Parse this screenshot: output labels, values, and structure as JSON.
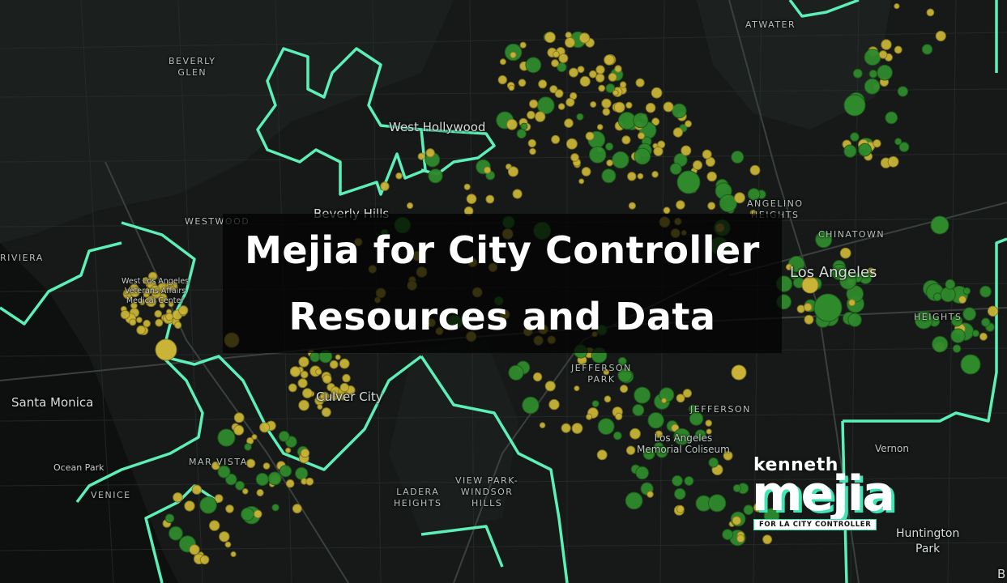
{
  "map": {
    "place_labels": {
      "beverly_glen": "BEVERLY\nGLEN",
      "atwater": "ATWATER",
      "west_hollywood": "West Hollywood",
      "westwood": "WESTWOOD",
      "beverly_hills": "Beverly Hills",
      "angelino_heights": "ANGELINO\nHEIGHTS",
      "chinatown": "CHINATOWN",
      "los_angeles": "Los Angeles",
      "riviera": "RIVIERA",
      "west_la_va": "West Los Angeles\nVeterans Affairs\nMedical Center",
      "heights": "HEIGHTS",
      "jefferson_park": "JEFFERSON\nPARK",
      "santa_monica": "Santa Monica",
      "culver_city": "Culver City",
      "jefferson": "JEFFERSON",
      "la_memorial_coliseum": "Los Angeles\nMemorial Coliseum",
      "vernon": "Vernon",
      "mar_vista": "MAR VISTA",
      "ocean_park": "Ocean Park",
      "venice": "VENICE",
      "ladera_heights": "LADERA\nHEIGHTS",
      "view_park_windsor_hills": "VIEW PARK-\nWINDSOR\nHILLS",
      "huntington_park": "Huntington\nPark",
      "edge_b": "B"
    }
  },
  "banner": {
    "line1": "Mejia for City Controller",
    "line2": "Resources and Data"
  },
  "logo": {
    "top": "kenneth",
    "name": "mejia",
    "tag": "FOR LA CITY CONTROLLER"
  },
  "colors": {
    "background": "#151817",
    "boundary": "#5cf0b8",
    "point_yellow": "#c9b437",
    "point_green": "#2f8a2c",
    "accent": "#3ee6b5"
  }
}
